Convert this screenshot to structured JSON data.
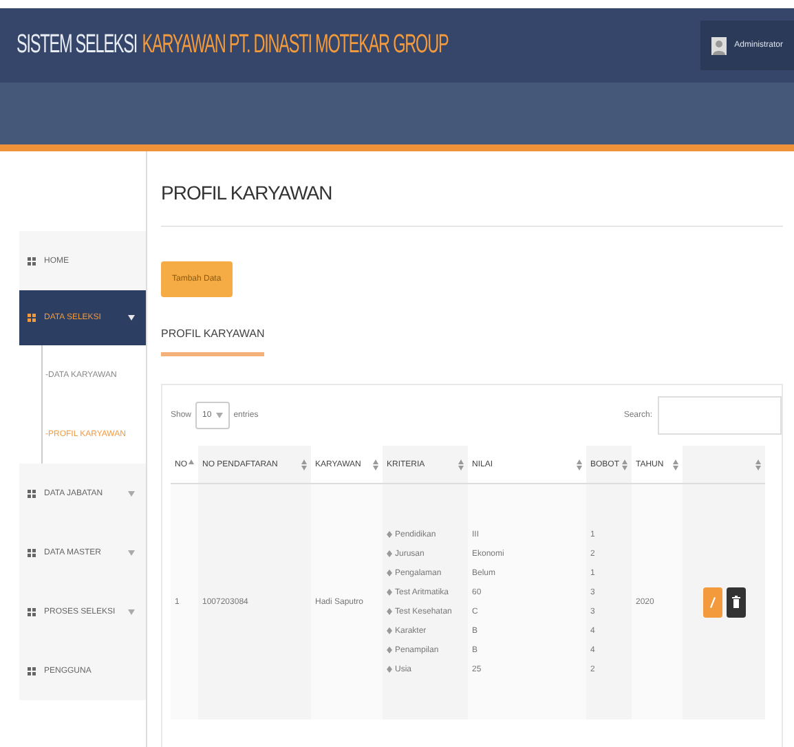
{
  "header": {
    "title_white": "SISTEM SELEKSI",
    "title_orange": "KARYAWAN PT. DINASTI MOTEKAR GROUP",
    "user": "Administrator"
  },
  "sidebar": {
    "items": [
      {
        "label": "HOME",
        "selected": false
      },
      {
        "label": "DATA SELEKSI",
        "selected": true,
        "expanded": true,
        "children": [
          {
            "label": "-DATA KARYAWAN",
            "selected": false
          },
          {
            "label": "-PROFIL KARYAWAN",
            "selected": true
          }
        ]
      },
      {
        "label": "DATA JABATAN",
        "selected": false,
        "expanded": false
      },
      {
        "label": "DATA MASTER",
        "selected": false,
        "expanded": false
      },
      {
        "label": "PROSES SELEKSI",
        "selected": false,
        "expanded": false
      },
      {
        "label": "PENGGUNA",
        "selected": false
      }
    ]
  },
  "page_title": "PROFIL KARYAWAN",
  "add_button": "Tambah Data",
  "section_title": "PROFIL KARYAWAN",
  "table": {
    "show_label": "Show",
    "page_size": "10",
    "entries_label": "entries",
    "search_label": "Search:",
    "columns": [
      {
        "label": "NO",
        "sorted": true
      },
      {
        "label": "NO PENDAFTARAN",
        "sorted": false
      },
      {
        "label": "KARYAWAN",
        "sorted": false
      },
      {
        "label": "KRITERIA",
        "sorted": false
      },
      {
        "label": "NILAI",
        "sorted": false
      },
      {
        "label": "BOBOT",
        "sorted": false
      },
      {
        "label": "TAHUN",
        "sorted": false
      },
      {
        "sorted": false
      }
    ],
    "rows": [
      {
        "no": "1",
        "registration": "1007203084",
        "employee": "Hadi Saputro",
        "year": "2020",
        "criteria": [
          {
            "name": "Pendidikan",
            "value": "III",
            "weight": "1"
          },
          {
            "name": "Jurusan",
            "value": "Ekonomi",
            "weight": "2"
          },
          {
            "name": "Pengalaman",
            "value": "Belum",
            "weight": "1"
          },
          {
            "name": "Test Aritmatika",
            "value": "60",
            "weight": "3"
          },
          {
            "name": "Test Kesehatan",
            "value": "C",
            "weight": "3"
          },
          {
            "name": "Karakter",
            "value": "B",
            "weight": "4"
          },
          {
            "name": "Penampilan",
            "value": "B",
            "weight": "4"
          },
          {
            "name": "Usia",
            "value": "25",
            "weight": "2"
          }
        ]
      }
    ]
  }
}
